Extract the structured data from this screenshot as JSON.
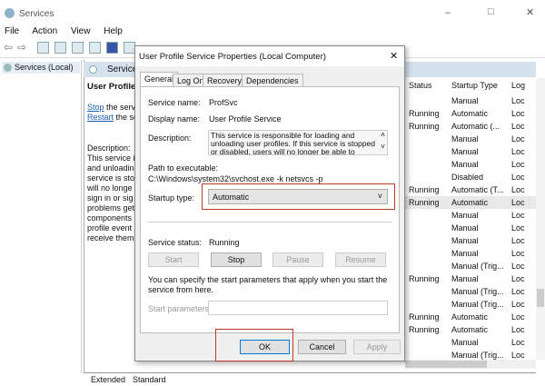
{
  "window": {
    "title": "Services",
    "controls": [
      "–",
      "□",
      "✕"
    ]
  },
  "menu": [
    "File",
    "Action",
    "View",
    "Help"
  ],
  "tree": {
    "root": "Services (Local)"
  },
  "panel": {
    "header": "Services",
    "service_title": "User Profile",
    "stop_link": "Stop",
    "stop_rest": "the serv",
    "restart_link": "Restart",
    "restart_rest": "the se",
    "desc_label": "Description:",
    "desc_lines": [
      "This service i",
      "and unloadin",
      "service is sto",
      "will no longe",
      "sign in or sig",
      "problems get",
      "components",
      "profile event",
      "receive them"
    ]
  },
  "columns": {
    "status": "Status",
    "startup": "Startup Type",
    "log": "Log"
  },
  "rows": [
    {
      "status": "",
      "startup": "Manual",
      "log": "Loc"
    },
    {
      "status": "Running",
      "startup": "Automatic",
      "log": "Loc"
    },
    {
      "status": "Running",
      "startup": "Automatic (...",
      "log": "Loc"
    },
    {
      "status": "",
      "startup": "Manual",
      "log": "Loc"
    },
    {
      "status": "",
      "startup": "Manual",
      "log": "Loc"
    },
    {
      "status": "",
      "startup": "Manual",
      "log": "Loc"
    },
    {
      "status": "",
      "startup": "Disabled",
      "log": "Loc"
    },
    {
      "status": "Running",
      "startup": "Automatic (T...",
      "log": "Loc"
    },
    {
      "status": "Running",
      "startup": "Automatic",
      "log": "Loc"
    },
    {
      "status": "",
      "startup": "Manual",
      "log": "Loc"
    },
    {
      "status": "",
      "startup": "Manual",
      "log": "Loc"
    },
    {
      "status": "",
      "startup": "Manual",
      "log": "Loc"
    },
    {
      "status": "",
      "startup": "Manual",
      "log": "Loc"
    },
    {
      "status": "",
      "startup": "Manual (Trig...",
      "log": "Loc"
    },
    {
      "status": "Running",
      "startup": "Manual",
      "log": "Loc"
    },
    {
      "status": "",
      "startup": "Manual (Trig...",
      "log": "Loc"
    },
    {
      "status": "",
      "startup": "Manual (Trig...",
      "log": "Loc"
    },
    {
      "status": "Running",
      "startup": "Automatic",
      "log": "Loc"
    },
    {
      "status": "Running",
      "startup": "Automatic",
      "log": "Loc"
    },
    {
      "status": "",
      "startup": "Manual",
      "log": "Loc"
    },
    {
      "status": "",
      "startup": "Manual (Trig...",
      "log": "Loc"
    }
  ],
  "bottom_tabs": [
    "Extended",
    "Standard"
  ],
  "dialog": {
    "title": "User Profile Service Properties (Local Computer)",
    "close": "✕",
    "tabs": [
      "General",
      "Log On",
      "Recovery",
      "Dependencies"
    ],
    "service_name_label": "Service name:",
    "service_name": "ProfSvc",
    "display_name_label": "Display name:",
    "display_name": "User Profile Service",
    "description_label": "Description:",
    "description": "This service is responsible for loading and unloading user profiles. If this service is stopped or disabled, users will no longer be able to successfully sign in or",
    "path_label": "Path to executable:",
    "path": "C:\\Windows\\system32\\svchost.exe -k netsvcs -p",
    "startup_label": "Startup type:",
    "startup_value": "Automatic",
    "status_label": "Service status:",
    "status_value": "Running",
    "buttons": {
      "start": "Start",
      "stop": "Stop",
      "pause": "Pause",
      "resume": "Resume"
    },
    "hint": "You can specify the start parameters that apply when you start the service from here.",
    "params_label": "Start parameters:",
    "params_value": "",
    "ok": "OK",
    "cancel": "Cancel",
    "apply": "Apply"
  }
}
